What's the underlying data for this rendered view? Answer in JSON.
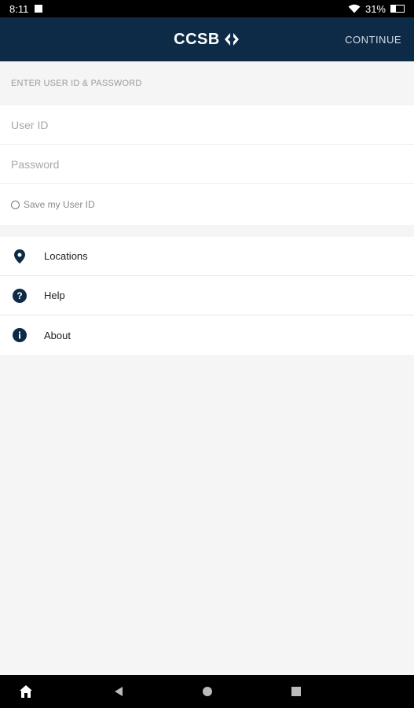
{
  "status": {
    "time": "8:11",
    "battery": "31%",
    "battery_level": 0.31
  },
  "header": {
    "logo_text": "CCSB",
    "continue_label": "CONTINUE"
  },
  "login": {
    "section_title": "ENTER USER ID & PASSWORD",
    "user_id_placeholder": "User ID",
    "password_placeholder": "Password",
    "save_label": "Save my User ID"
  },
  "menu": {
    "items": [
      {
        "label": "Locations",
        "icon": "location-pin-icon"
      },
      {
        "label": "Help",
        "icon": "help-icon"
      },
      {
        "label": "About",
        "icon": "info-icon"
      }
    ]
  },
  "nav": {
    "icons": [
      "home-icon",
      "back-icon",
      "home-circle-icon",
      "recents-icon"
    ]
  },
  "colors": {
    "app_bar": "#0d2a47",
    "icon": "#0d2a47",
    "background": "#f5f5f5"
  }
}
